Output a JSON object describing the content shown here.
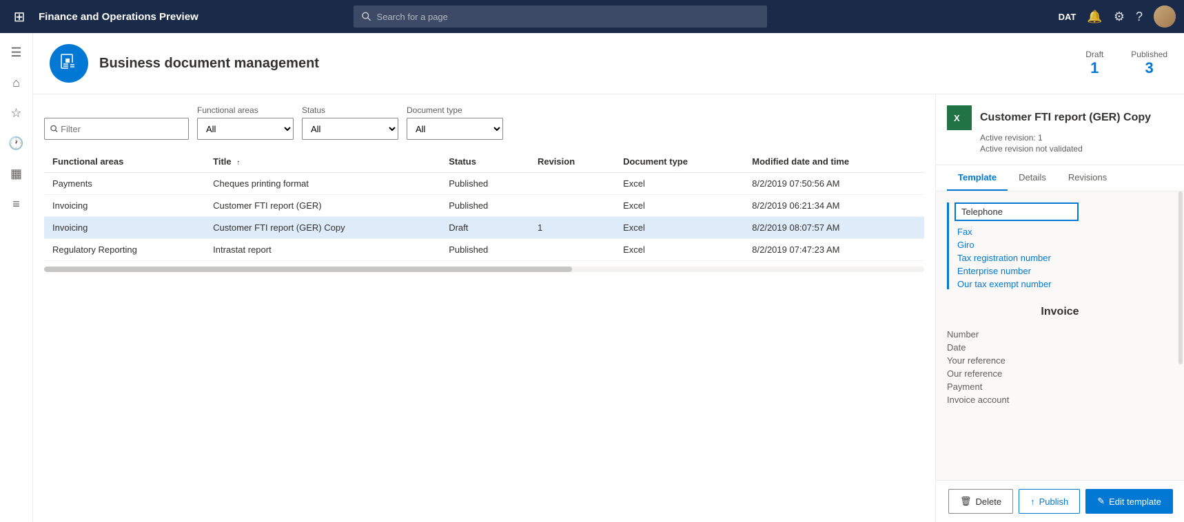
{
  "topnav": {
    "title": "Finance and Operations Preview",
    "search_placeholder": "Search for a page",
    "env": "DAT"
  },
  "page_header": {
    "title": "Business document management",
    "stats": {
      "draft_label": "Draft",
      "draft_value": "1",
      "published_label": "Published",
      "published_value": "3"
    }
  },
  "filters": {
    "search_placeholder": "Filter",
    "functional_areas_label": "Functional areas",
    "functional_areas_value": "All",
    "status_label": "Status",
    "status_value": "All",
    "document_type_label": "Document type",
    "document_type_value": "All"
  },
  "table": {
    "columns": [
      "Functional areas",
      "Title",
      "Status",
      "Revision",
      "Document type",
      "Modified date and time"
    ],
    "rows": [
      {
        "functional_areas": "Payments",
        "title": "Cheques printing format",
        "status": "Published",
        "revision": "",
        "document_type": "Excel",
        "modified": "8/2/2019 07:50:56 AM",
        "selected": false
      },
      {
        "functional_areas": "Invoicing",
        "title": "Customer FTI report (GER)",
        "status": "Published",
        "revision": "",
        "document_type": "Excel",
        "modified": "8/2/2019 06:21:34 AM",
        "selected": false
      },
      {
        "functional_areas": "Invoicing",
        "title": "Customer FTI report (GER) Copy",
        "status": "Draft",
        "revision": "1",
        "document_type": "Excel",
        "modified": "8/2/2019 08:07:57 AM",
        "selected": true
      },
      {
        "functional_areas": "Regulatory Reporting",
        "title": "Intrastat report",
        "status": "Published",
        "revision": "",
        "document_type": "Excel",
        "modified": "8/2/2019 07:47:23 AM",
        "selected": false
      }
    ]
  },
  "right_panel": {
    "title": "Customer FTI report (GER) Copy",
    "subtitle_line1": "Active revision: 1",
    "subtitle_line2": "Active revision not validated",
    "tabs": [
      "Template",
      "Details",
      "Revisions"
    ],
    "active_tab": "Template",
    "template_preview": {
      "telephone_label": "Telephone",
      "links": [
        "Fax",
        "Giro",
        "Tax registration number",
        "Enterprise number",
        "Our tax exempt number"
      ],
      "section_title": "Invoice",
      "fields": [
        "Number",
        "Date",
        "Your reference",
        "Our reference",
        "Payment",
        "Invoice account"
      ]
    },
    "buttons": {
      "delete": "Delete",
      "publish": "Publish",
      "edit_template": "Edit template"
    }
  }
}
